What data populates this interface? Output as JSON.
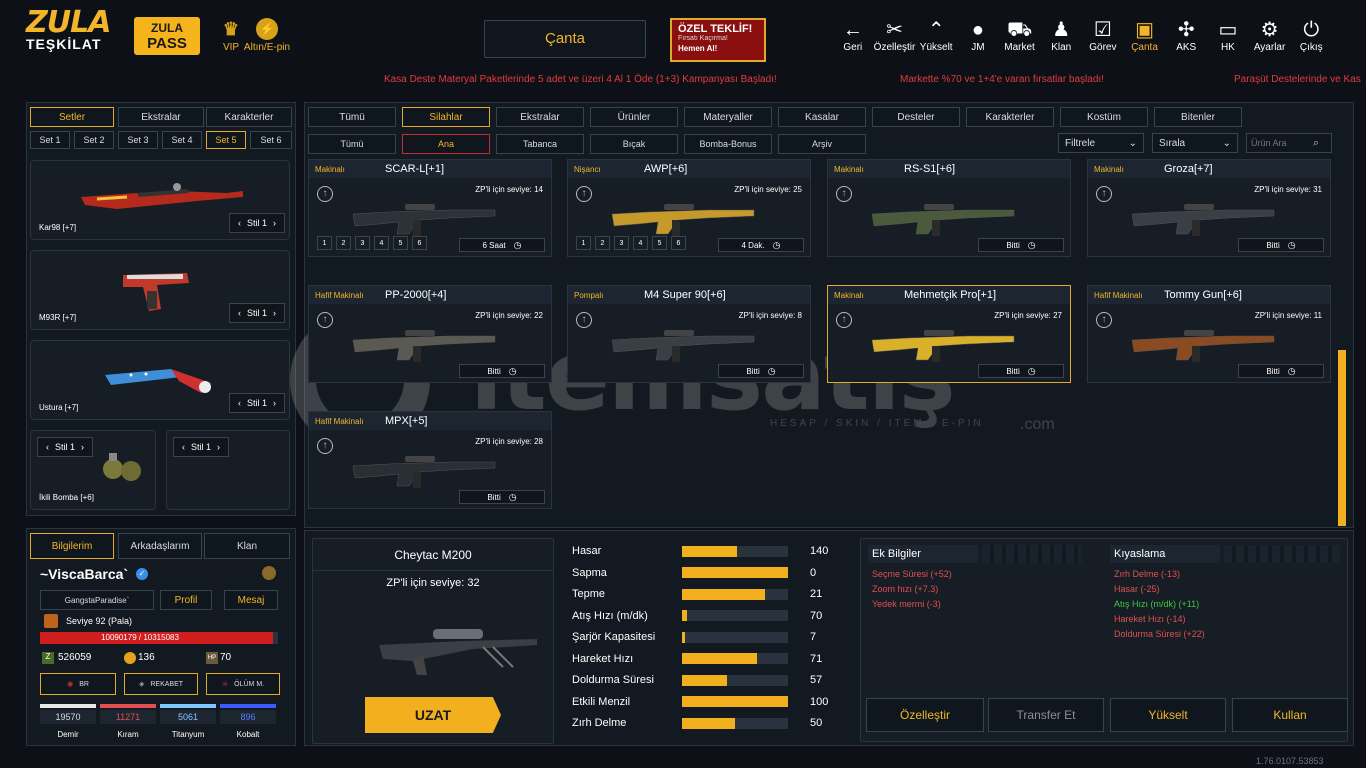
{
  "logo": {
    "line1": "ZULA",
    "line2": "TEŞKİLAT"
  },
  "pass": {
    "line1": "ZULA",
    "line2": "PASS"
  },
  "vip": {
    "label": "VIP"
  },
  "epin": {
    "label": "Altın/E-pin"
  },
  "header": {
    "canta": "Çanta"
  },
  "offer": {
    "title": "ÖZEL TEKLİF!",
    "sub": "Fırsatı Kaçırma!",
    "cta": "Hemen Al!"
  },
  "nav": [
    {
      "label": "Geri",
      "icon": "←"
    },
    {
      "label": "Özelleştir",
      "icon": "✂"
    },
    {
      "label": "Yükselt",
      "icon": "⌃"
    },
    {
      "label": "JM",
      "icon": "●"
    },
    {
      "label": "Market",
      "icon": "⛟"
    },
    {
      "label": "Klan",
      "icon": "♟"
    },
    {
      "label": "Görev",
      "icon": "☑"
    },
    {
      "label": "Çanta",
      "icon": "▣"
    },
    {
      "label": "AKS",
      "icon": "✣"
    },
    {
      "label": "HK",
      "icon": "▭"
    },
    {
      "label": "Ayarlar",
      "icon": "⚙"
    },
    {
      "label": "Çıkış",
      "icon": "⏻"
    }
  ],
  "ticker": {
    "t1": "Kasa Deste Materyal Paketlerinde 5 adet ve üzeri 4 Al 1 Öde (1+3) Kampanyası Başladı!",
    "t2": "Markette %70 ve 1+4'e varan fırsatlar başladı!",
    "t3": "Paraşüt Destelerinde ve Kas"
  },
  "left": {
    "tabs": [
      "Setler",
      "Ekstralar",
      "Karakterler"
    ],
    "sets": [
      "Set 1",
      "Set 2",
      "Set 3",
      "Set 4",
      "Set 5",
      "Set 6"
    ],
    "stil": "Stil 1",
    "items": [
      "Kar98 [+7]",
      "M93R [+7]",
      "Ustura [+7]",
      "İkili Bomba [+6]"
    ]
  },
  "profile": {
    "tabs": [
      "Bilgilerim",
      "Arkadaşlarım",
      "Klan"
    ],
    "name": "~ViscaBarca`",
    "clan": "GangstaParadise`",
    "profile_btn": "Profil",
    "message_btn": "Mesaj",
    "level": "Seviye 92 (Pala)",
    "xp": "10090179 / 10315083",
    "xp_ratio": 0.978,
    "zp": "526059",
    "gold": "136",
    "hp": "70",
    "modes": [
      "BR",
      "REKABET",
      "ÖLÜM M."
    ],
    "materials": [
      {
        "v": "19570",
        "n": "Demir",
        "c": "#e8e8e8"
      },
      {
        "v": "11271",
        "n": "Kıram",
        "c": "#e05050"
      },
      {
        "v": "5061",
        "n": "Titanyum",
        "c": "#7fc8ff"
      },
      {
        "v": "896",
        "n": "Kobalt",
        "c": "#3b5bff"
      }
    ]
  },
  "filters": {
    "main": [
      "Tümü",
      "Silahlar",
      "Ekstralar",
      "Ürünler",
      "Materyaller",
      "Kasalar",
      "Desteler",
      "Karakterler",
      "Kostüm",
      "Bitenler"
    ],
    "sub": [
      "Tümü",
      "Ana",
      "Tabanca",
      "Bıçak",
      "Bomba-Bonus",
      "Arşiv"
    ],
    "filter": "Filtrele",
    "sort": "Sırala",
    "search_placeholder": "Ürün Ara"
  },
  "weapons": [
    {
      "cat": "Makinalı",
      "name": "SCAR-L[+1]",
      "zp": "ZP'li için seviye: 14",
      "time": "6 Saat",
      "slots": [
        "1",
        "2",
        "3",
        "4",
        "5",
        "6"
      ]
    },
    {
      "cat": "Nişancı",
      "name": "AWP[+6]",
      "zp": "ZP'li için seviye: 25",
      "time": "4 Dak.",
      "slots": [
        "1",
        "2",
        "3",
        "4",
        "5",
        "6"
      ]
    },
    {
      "cat": "Makinalı",
      "name": "RS-S1[+6]",
      "zp": "",
      "time": "Bitti"
    },
    {
      "cat": "Makinalı",
      "name": "Groza[+7]",
      "zp": "ZP'li için seviye: 31",
      "time": "Bitti"
    },
    {
      "cat": "Hafif Makinalı",
      "name": "PP-2000[+4]",
      "zp": "ZP'li için seviye: 22",
      "time": "Bitti"
    },
    {
      "cat": "Pompalı",
      "name": "M4 Super 90[+6]",
      "zp": "ZP'li için seviye: 8",
      "time": "Bitti"
    },
    {
      "cat": "Makinalı",
      "name": "Mehmetçik Pro[+1]",
      "zp": "ZP'li için seviye: 27",
      "time": "Bitti"
    },
    {
      "cat": "Hafif Makinalı",
      "name": "Tommy Gun[+6]",
      "zp": "ZP'li için seviye: 11",
      "time": "Bitti"
    },
    {
      "cat": "Hafif Makinalı",
      "name": "MPX[+5]",
      "zp": "ZP'li için seviye: 28",
      "time": "Bitti"
    }
  ],
  "selected": {
    "name": "Cheytac M200",
    "zp": "ZP'li için seviye: 32",
    "uzat": "UZAT"
  },
  "stats": [
    {
      "n": "Hasar",
      "v": "140",
      "f": 0.52
    },
    {
      "n": "Sapma",
      "v": "0",
      "f": 1.0
    },
    {
      "n": "Tepme",
      "v": "21",
      "f": 0.78
    },
    {
      "n": "Atış Hızı (m/dk)",
      "v": "70",
      "f": 0.05
    },
    {
      "n": "Şarjör Kapasitesi",
      "v": "7",
      "f": 0.03
    },
    {
      "n": "Hareket Hızı",
      "v": "71",
      "f": 0.71
    },
    {
      "n": "Doldurma Süresi",
      "v": "57",
      "f": 0.42
    },
    {
      "n": "Etkili Menzil",
      "v": "100",
      "f": 1.0
    },
    {
      "n": "Zırh Delme",
      "v": "50",
      "f": 0.5
    }
  ],
  "extra": {
    "title": "Ek Bilgiler",
    "items": [
      {
        "t": "Seçme Süresi (+52)",
        "c": "#e05050"
      },
      {
        "t": "Zoom hızı (+7.3)",
        "c": "#e05050"
      },
      {
        "t": "Yedek mermi (-3)",
        "c": "#e05050"
      }
    ]
  },
  "compare": {
    "title": "Kıyaslama",
    "items": [
      {
        "t": "Zırh Delme (-13)",
        "c": "#e05050"
      },
      {
        "t": "Hasar (-25)",
        "c": "#e05050"
      },
      {
        "t": "Atış Hızı (m/dk) (+11)",
        "c": "#3ec93e"
      },
      {
        "t": "Hareket Hızı (-14)",
        "c": "#e05050"
      },
      {
        "t": "Doldurma Süresi (+22)",
        "c": "#e05050"
      }
    ]
  },
  "actions": [
    "Özelleştir",
    "Transfer Et",
    "Yükselt",
    "Kullan"
  ],
  "version": "1.76.0107.53853",
  "watermark": {
    "brand": "itemsatış",
    "tagline": "HESAP / SKIN / ITEM / E-PIN",
    "dotcom": ".com"
  }
}
